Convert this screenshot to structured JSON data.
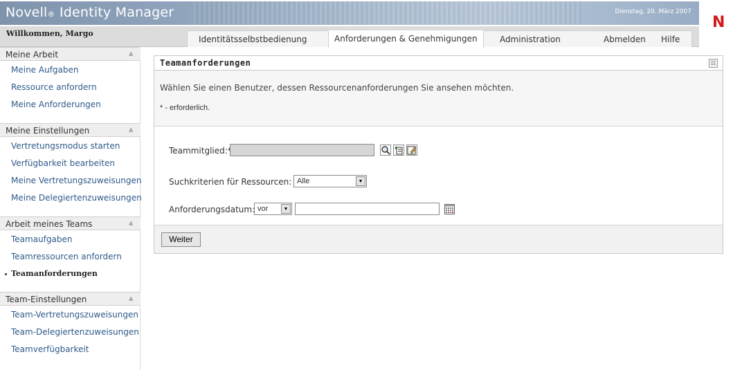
{
  "header": {
    "app_title": "Novell",
    "app_title_reg": "®",
    "app_title_rest": " Identity Manager",
    "date": "Dienstag, 20. März 2007",
    "logo_letter": "N",
    "welcome": "Willkommen, Margo"
  },
  "tabs": [
    {
      "label": "Identitätsselbstbedienung",
      "active": false
    },
    {
      "label": "Anforderungen & Genehmigungen",
      "active": true
    },
    {
      "label": "Administration",
      "active": false
    },
    {
      "label": "Abmelden",
      "active": false
    },
    {
      "label": "Hilfe",
      "active": false
    }
  ],
  "sidebar": {
    "sections": [
      {
        "title": "Meine Arbeit",
        "items": [
          "Meine Aufgaben",
          "Ressource anfordern",
          "Meine Anforderungen"
        ]
      },
      {
        "title": "Meine Einstellungen",
        "items": [
          "Vertretungsmodus starten",
          "Verfügbarkeit bearbeiten",
          "Meine Vertretungszuweisungen",
          "Meine Delegiertenzuweisungen"
        ]
      },
      {
        "title": "Arbeit meines Teams",
        "items": [
          "Teamaufgaben",
          "Teamressourcen anfordern",
          "Teamanforderungen"
        ]
      },
      {
        "title": "Team-Einstellungen",
        "items": [
          "Team-Vertretungszuweisungen",
          "Team-Delegiertenzuweisungen",
          "Teamverfügbarkeit"
        ]
      }
    ],
    "current_item": "Teamanforderungen"
  },
  "panel": {
    "title": "Teamanforderungen",
    "instruction": "Wählen Sie einen Benutzer, dessen Ressourcenanforderungen Sie ansehen möchten.",
    "required_note": "* - erforderlich.",
    "team_member_label": "Teammitglied:*",
    "team_member_value": "",
    "search_criteria_label": "Suchkriterien für Ressourcen:",
    "search_criteria_value": "Alle",
    "request_date_label": "Anforderungsdatum:",
    "request_date_operator": "vor",
    "request_date_value": "",
    "continue_button": "Weiter"
  },
  "colors": {
    "banner": "#8fa4bc",
    "link": "#2e5a8a",
    "logo": "#d11a1a"
  }
}
